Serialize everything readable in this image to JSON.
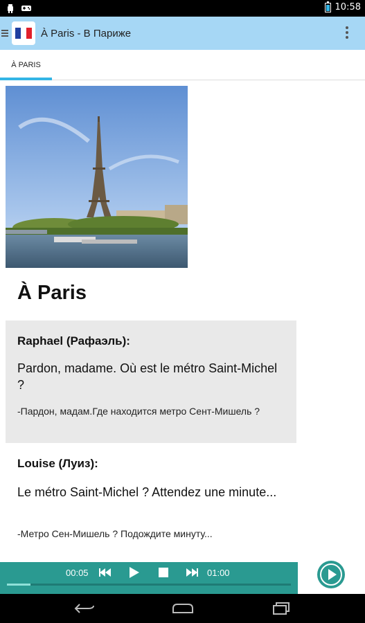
{
  "status_bar": {
    "time": "10:58",
    "left_icons": [
      "android-icon",
      "gamepad-icon"
    ],
    "right_icons": [
      "battery-icon"
    ]
  },
  "app_bar": {
    "title": "À Paris - В Париже",
    "logo": "french-flag-icon",
    "menu_icon": "overflow-menu-icon"
  },
  "tabs": [
    {
      "label": "À PARIS",
      "selected": true
    }
  ],
  "lesson": {
    "photo": "eiffel-tower-photo",
    "title": "À Paris",
    "dialog": [
      {
        "speaker": "Raphael (Рафаэль):",
        "french": "Pardon, madame. Où est le métro Saint-Michel ?",
        "russian": "-Пардон, мадам.Где находится метро Сент-Мишель ?",
        "highlighted": true
      },
      {
        "speaker": "Louise (Луиз):",
        "french": "Le métro Saint-Michel ? Attendez une minute...",
        "russian": "-Метро Сен-Мишель ? Подождите минуту...",
        "highlighted": false
      }
    ]
  },
  "player": {
    "current_time": "00:05",
    "total_time": "01:00",
    "progress_fraction": 0.083,
    "controls": [
      "rewind-icon",
      "play-icon",
      "stop-icon",
      "fast-forward-icon"
    ],
    "fab_icon": "play-circle-icon"
  },
  "colors": {
    "app_bar": "#a6d7f5",
    "accent": "#33b5e5",
    "player": "#2a9a91",
    "highlight_block": "#e9e9e9"
  },
  "nav_bar": [
    "back-icon",
    "home-icon",
    "recent-apps-icon"
  ]
}
